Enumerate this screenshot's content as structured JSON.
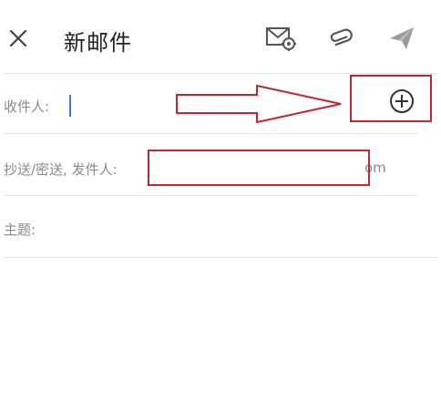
{
  "header": {
    "close_icon": "close-icon",
    "title": "新邮件",
    "actions": [
      {
        "name": "mail-settings",
        "icon": "mail-settings-icon"
      },
      {
        "name": "attachment",
        "icon": "paperclip-icon"
      },
      {
        "name": "send",
        "icon": "send-icon"
      }
    ]
  },
  "form": {
    "to_label": "收件人:",
    "to_value": "",
    "add_recipient_icon": "add-circle-icon",
    "cc_label": "抄送/密送, 发件人:",
    "cc_suffix": "om",
    "subject_label": "主题:"
  },
  "annotations": {
    "color": "#c0282f"
  },
  "colors": {
    "label": "#8a8a8a",
    "title": "#222222",
    "caret": "#3a7bd5",
    "icon": "#555555",
    "send_icon_disabled": "#9a9a9a"
  }
}
